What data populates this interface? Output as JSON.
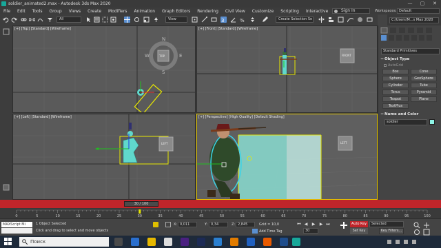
{
  "window": {
    "title": "soldier_animated2.max - Autodesk 3ds Max 2020",
    "minimize": "—",
    "maximize": "▢",
    "close": "✕"
  },
  "menu": [
    "File",
    "Edit",
    "Tools",
    "Group",
    "Views",
    "Create",
    "Modifiers",
    "Animation",
    "Graph Editors",
    "Rendering",
    "Civil View",
    "Customize",
    "Scripting",
    "Interactive"
  ],
  "signin": "Sign In",
  "workspaces": {
    "label": "Workspaces:",
    "value": "Default"
  },
  "toolbar": {
    "filter": "All",
    "view": "View",
    "selection_set": "Create Selection Se"
  },
  "project_path": "C:\\Users\\M...s Max 2020",
  "viewports": {
    "top": {
      "label": "[+] [Top] [Standard] [Wireframe]",
      "cube": "TOP",
      "compass": {
        "n": "N",
        "s": "S",
        "e": "E",
        "w": "W"
      }
    },
    "front": {
      "label": "[+] [Front] [Standard] [Wireframe]",
      "cube": "FRONT"
    },
    "left": {
      "label": "[+] [Left] [Standard] [Wireframe]",
      "cube": "LEFT"
    },
    "perspective": {
      "label": "[+] [Perspective] [High Quality] [Default Shading]",
      "cube": "LEFT"
    }
  },
  "command_panel": {
    "dropdown": "Standard Primitives",
    "object_type": {
      "header": "Object Type",
      "autogrid": "AutoGrid",
      "buttons": [
        "Box",
        "Cone",
        "Sphere",
        "GeoSphere",
        "Cylinder",
        "Tube",
        "Torus",
        "Pyramid",
        "Teapot",
        "Plane",
        "TextPlus"
      ]
    },
    "name_color": {
      "header": "Name and Color",
      "name": "soldier",
      "color": "#8ef5e6"
    }
  },
  "time_slider": {
    "position": "30 / 100",
    "current": 30,
    "total": 100
  },
  "track_ticks": [
    "0",
    "5",
    "10",
    "15",
    "20",
    "25",
    "30",
    "35",
    "40",
    "45",
    "50",
    "55",
    "60",
    "65",
    "70",
    "75",
    "80",
    "85",
    "90",
    "95",
    "100"
  ],
  "status": {
    "maxscript": "MAXScript Mi",
    "selected": "1 Object Selected",
    "prompt": "Click and drag to select and move objects",
    "x_label": "X:",
    "x": "0,011",
    "y_label": "Y:",
    "y": "0,34",
    "z_label": "Z:",
    "z": "2,845",
    "grid": "Grid = 10,0",
    "add_time_tag": "Add Time Tag",
    "frame": "30",
    "auto_key": "Auto Key",
    "set_key": "Set Key",
    "selected_dropdown": "Selected",
    "key_filters": "Key Filters..."
  },
  "taskbar": {
    "search": "Поиск"
  }
}
